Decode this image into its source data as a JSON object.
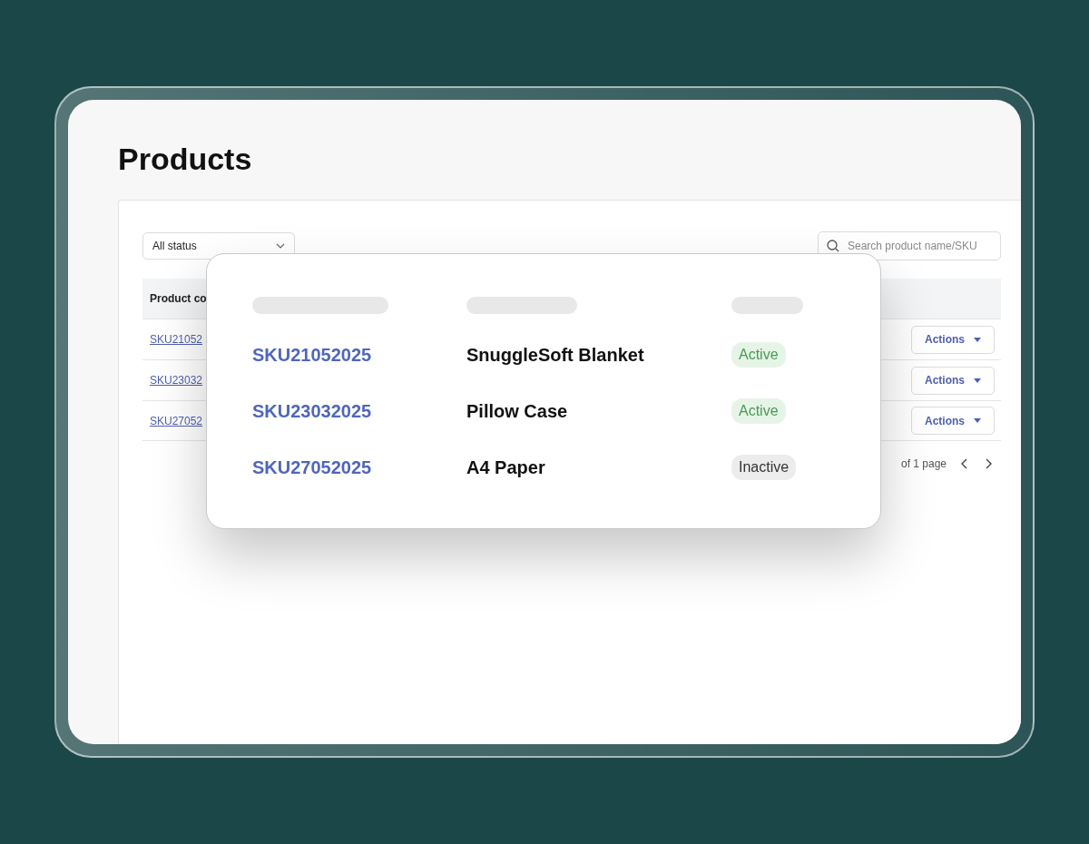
{
  "page": {
    "title": "Products"
  },
  "filters": {
    "status_select": "All status",
    "search": {
      "placeholder": "Search product name/SKU"
    }
  },
  "table": {
    "columns": [
      "Product co"
    ],
    "rows": [
      {
        "code": "SKU21052",
        "action": "Actions"
      },
      {
        "code": "SKU23032",
        "action": "Actions"
      },
      {
        "code": "SKU27052",
        "action": "Actions"
      }
    ]
  },
  "pagination": {
    "text": "of 1 page"
  },
  "popup": {
    "rows": [
      {
        "sku": "SKU21052025",
        "name": "SnuggleSoft Blanket",
        "status": "Active",
        "active": true
      },
      {
        "sku": "SKU23032025",
        "name": "Pillow Case",
        "status": "Active",
        "active": true
      },
      {
        "sku": "SKU27052025",
        "name": "A4 Paper",
        "status": "Inactive",
        "active": false
      }
    ]
  }
}
